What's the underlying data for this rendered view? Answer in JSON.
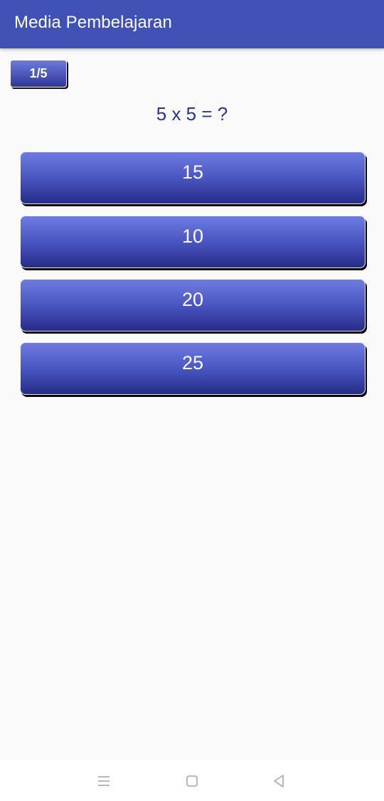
{
  "app_bar": {
    "title": "Media Pembelajaran",
    "color": "#3f51b5"
  },
  "quiz": {
    "progress": "1/5",
    "question": "5 x 5 = ?",
    "answers": [
      "15",
      "10",
      "20",
      "25"
    ]
  },
  "nav_bar": {
    "icons": [
      "menu-icon",
      "home-icon",
      "back-icon"
    ]
  }
}
